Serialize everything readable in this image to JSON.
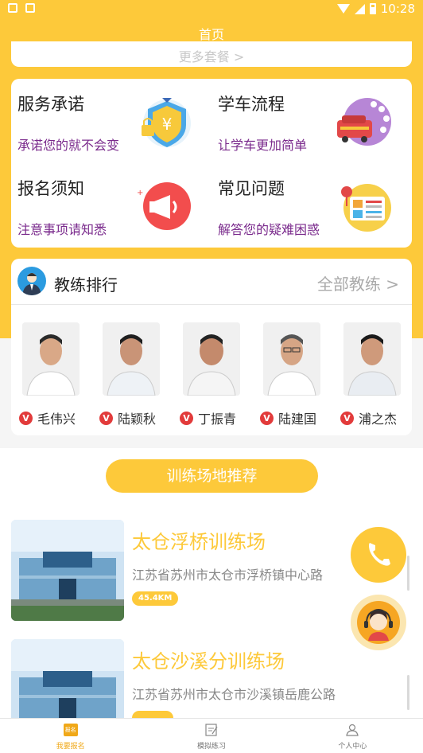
{
  "status_bar": {
    "time": "10:28"
  },
  "header": {
    "title": "首页"
  },
  "packages": {
    "more_label": "更多套餐 >"
  },
  "services": [
    {
      "title": "服务承诺",
      "subtitle": "承诺您的就不会变",
      "icon": "shield-yen-icon"
    },
    {
      "title": "学车流程",
      "subtitle": "让学车更加简单",
      "icon": "car-process-icon"
    },
    {
      "title": "报名须知",
      "subtitle": "注意事项请知悉",
      "icon": "megaphone-icon"
    },
    {
      "title": "常见问题",
      "subtitle": "解答您的疑难困惑",
      "icon": "faq-board-icon"
    }
  ],
  "coach_section": {
    "title": "教练排行",
    "all_label": "全部教练 >",
    "badge": "V",
    "coaches": [
      {
        "name": "毛伟兴"
      },
      {
        "name": "陆颖秋"
      },
      {
        "name": "丁振青"
      },
      {
        "name": "陆建国"
      },
      {
        "name": "浦之杰"
      }
    ]
  },
  "venue_section": {
    "title": "训练场地推荐",
    "venues": [
      {
        "name": "太仓浮桥训练场",
        "address": "江苏省苏州市太仓市浮桥镇中心路",
        "distance": "45.4KM"
      },
      {
        "name": "太仓沙溪分训练场",
        "address": "江苏省苏州市太仓市沙溪镇岳鹿公路",
        "distance": ""
      }
    ]
  },
  "bottom_nav": [
    {
      "label": "我要报名",
      "badge": "报名",
      "active": true
    },
    {
      "label": "模拟练习",
      "active": false
    },
    {
      "label": "个人中心",
      "active": false
    }
  ],
  "colors": {
    "accent": "#fdc93a",
    "subtitle": "#7a2a8c",
    "badge_red": "#e23b3b"
  }
}
